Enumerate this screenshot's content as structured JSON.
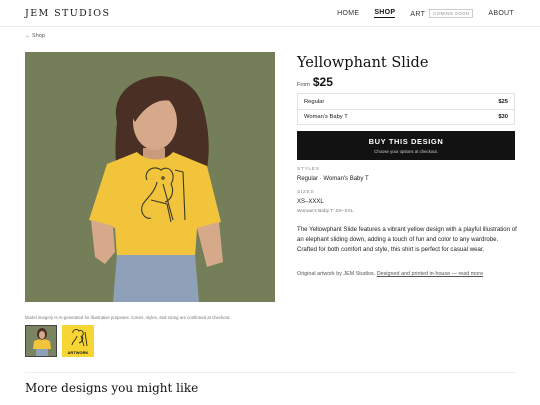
{
  "header": {
    "logo": "JEM STUDIOS",
    "nav": {
      "home": "HOME",
      "shop": "SHOP",
      "art": "ART",
      "art_badge": "COMING SOON",
      "about": "ABOUT"
    }
  },
  "breadcrumb": {
    "back": "← Shop"
  },
  "gallery": {
    "disclaimer": "Model imagery is AI-generated for illustrative purposes. Colors, styles, and sizing are confirmed at checkout.",
    "thumbnails": [
      {
        "kind": "model-photo",
        "label": ""
      },
      {
        "kind": "artwork",
        "label": "ARTWORK"
      }
    ]
  },
  "product": {
    "title": "Yellowphant Slide",
    "from_label": "From",
    "price": "$25",
    "variants": [
      {
        "name": "Regular",
        "price": "$25"
      },
      {
        "name": "Woman's Baby T",
        "price": "$30"
      }
    ],
    "buy": {
      "label": "BUY THIS DESIGN",
      "sub": "Choose your options at checkout."
    },
    "styles_label": "STYLES",
    "styles_value": "Regular · Woman's Baby T",
    "sizes_label": "SIZES",
    "sizes_value": "XS–XXXL",
    "sizes_sub": "Woman's Baby T: XS–XXL",
    "description": "The Yellowphant Slide features a vibrant yellow design with a playful illustration of an elephant sliding down, adding a touch of fun and color to any wardrobe. Crafted for both comfort and style, this shirt is perfect for casual wear.",
    "origin_text": "Original artwork by JEM Studios.",
    "origin_link": "Designed and printed in-house — read more"
  },
  "more": {
    "title": "More designs you might like"
  },
  "colors": {
    "image_bg": "#747f59",
    "shirt": "#f2c43c",
    "buy_button": "#121212"
  }
}
